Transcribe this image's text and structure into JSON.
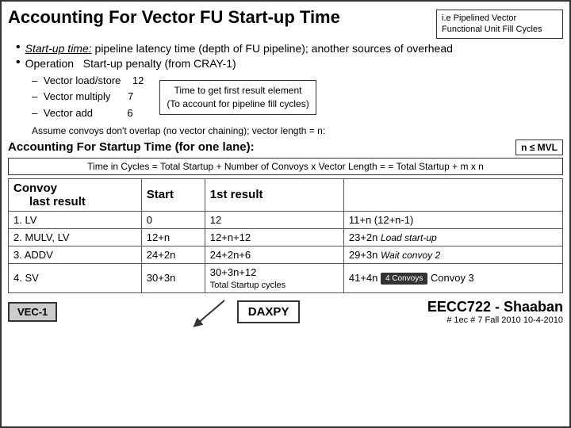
{
  "slide": {
    "main_title": "Accounting For Vector FU Start-up Time",
    "header_note": "i.e Pipelined Vector Functional Unit Fill Cycles",
    "bullets": [
      {
        "label_underline": "Start-up time:",
        "text": " pipeline latency time (depth of FU pipeline); another sources of overhead"
      },
      {
        "text": "Operation   Start-up penalty (from CRAY-1)"
      }
    ],
    "ops": [
      {
        "name": "Vector load/store",
        "value": "12"
      },
      {
        "name": "Vector multiply",
        "value": "7"
      },
      {
        "name": "Vector add",
        "value": "6"
      }
    ],
    "ops_note_line1": "Time to get first result element",
    "ops_note_line2": "(To account for pipeline fill cycles)",
    "assume_text": "Assume convoys don't overlap (no vector chaining); vector length = n:",
    "startup_section_title": "Accounting For Startup Time (for one lane):",
    "mvl_badge": "n ≤ MVL",
    "time_formula": "Time in Cycles = Total Startup + Number of Convoys x Vector Length = = Total Startup + m x n",
    "table": {
      "headers": [
        "Convoy\n   last result",
        "Start",
        "1st result",
        ""
      ],
      "rows": [
        {
          "num": "1. LV",
          "start": "0",
          "first_result": "12",
          "last_result": "11+n (12+n-1)"
        },
        {
          "num": "2. MULV, LV",
          "start": "12+n",
          "first_result": "12+n+12",
          "last_result": "23+2n Load start-up"
        },
        {
          "num": "3. ADDV",
          "start": "24+2n",
          "first_result": "24+2n+6",
          "last_result": "29+3n Wait convoy 2"
        },
        {
          "num": "4. SV",
          "start": "30+3n",
          "first_result": "30+3n+12",
          "last_result": "41+4n"
        }
      ],
      "row4_note": "4 Convoys",
      "row4_convoy_text": "oy 3",
      "total_startup_label": "Total Startup cycles"
    },
    "daxpy_label": "DAXPY",
    "vec1_label": "VEC-1",
    "convoys_label": "Convoys",
    "eecc_title": "EECC722 - Shaaban",
    "course_info": "#  1ec # 7   Fall 2010  10-4-2010"
  }
}
